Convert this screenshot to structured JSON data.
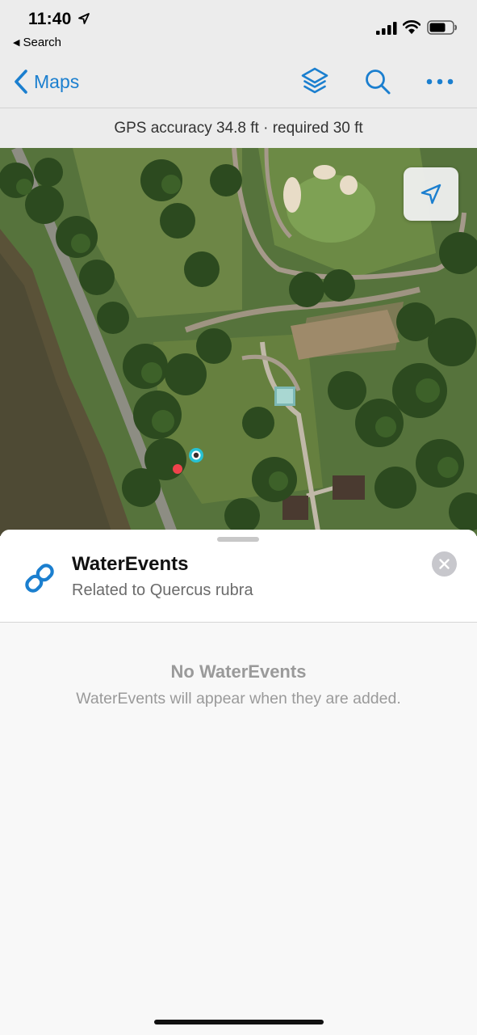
{
  "status_bar": {
    "time": "11:40",
    "back_app_label": "Search",
    "location_icon": "location-arrow-icon",
    "signal_icon": "cellular-signal-icon",
    "wifi_icon": "wifi-icon",
    "battery_icon": "battery-icon"
  },
  "nav": {
    "back_label": "Maps",
    "back_icon": "chevron-left-icon",
    "layers_icon": "layers-icon",
    "search_icon": "search-icon",
    "more_icon": "more-ellipsis-icon"
  },
  "gps_banner": {
    "text": "GPS accuracy 34.8 ft · required 30 ft"
  },
  "map": {
    "locate_icon": "navigation-arrow-icon",
    "feature_marker_icon": "feature-marker-icon",
    "current_location_icon": "gps-location-dot-icon"
  },
  "sheet": {
    "link_icon": "link-chain-icon",
    "title": "WaterEvents",
    "subtitle": "Related to Quercus rubra",
    "close_icon": "close-icon",
    "empty_title": "No WaterEvents",
    "empty_message": "WaterEvents will appear when they are added."
  },
  "colors": {
    "accent": "#1b7fcf",
    "chrome_background": "#ececec",
    "sheet_background": "#f8f8f8",
    "muted_text": "#9a9a9a",
    "marker_red": "#f0424c",
    "location_cyan": "#27c1d3"
  }
}
